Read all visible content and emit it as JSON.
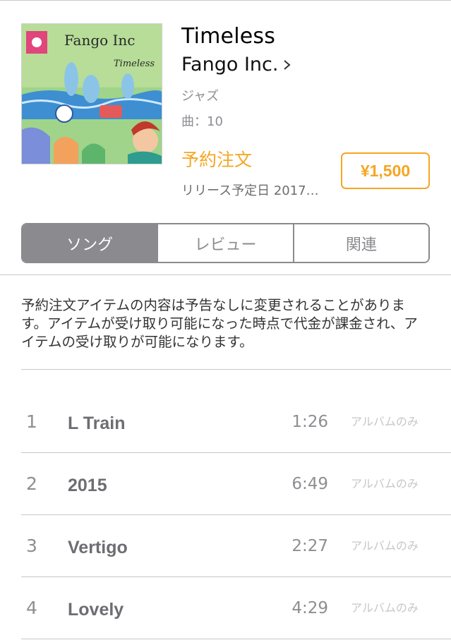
{
  "album": {
    "title": "Timeless",
    "artist": "Fango Inc.",
    "genre": "ジャズ",
    "track_count": "曲：10",
    "preorder_label": "予約注文",
    "release": "リリース予定日 2017…",
    "price": "¥1,500",
    "cover_text": {
      "logo": "Fango Inc",
      "subtitle": "Timeless"
    }
  },
  "tabs": [
    {
      "label": "ソング",
      "selected": true
    },
    {
      "label": "レビュー",
      "selected": false
    },
    {
      "label": "関連",
      "selected": false
    }
  ],
  "notice": "予約注文アイテムの内容は予告なしに変更されることがあります。アイテムが受け取り可能になった時点で代金が課金され、アイテムの受け取りが可能になります。",
  "tracks": [
    {
      "num": "1",
      "name": "L Train",
      "duration": "1:26",
      "note": "アルバムのみ"
    },
    {
      "num": "2",
      "name": "2015",
      "duration": "6:49",
      "note": "アルバムのみ"
    },
    {
      "num": "3",
      "name": "Vertigo",
      "duration": "2:27",
      "note": "アルバムのみ"
    },
    {
      "num": "4",
      "name": "Lovely",
      "duration": "4:29",
      "note": "アルバムのみ"
    }
  ],
  "colors": {
    "accent": "#f5a623",
    "segment": "#8a8a8f",
    "divider": "#c8c7cc"
  }
}
